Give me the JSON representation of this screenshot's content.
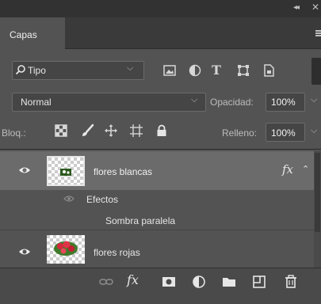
{
  "panel": {
    "collapse_glyph": "◂◂",
    "close_glyph": "✕",
    "tab_label": "Capas",
    "menu_icon": "panel-menu-icon"
  },
  "filter": {
    "kind_label": "Tipo",
    "search_icon": "search-icon",
    "chevron": "⌵",
    "filter_icons": [
      "image-icon",
      "adjustment-icon",
      "text-icon",
      "shape-icon",
      "smart-object-icon"
    ],
    "text_glyph": "T"
  },
  "blend": {
    "mode": "Normal",
    "chevron": "⌵",
    "opacity_label": "Opacidad:",
    "opacity_value": "100%"
  },
  "lock": {
    "label": "Bloq.:",
    "icons": [
      "lock-transparent-pixels-icon",
      "lock-image-pixels-icon",
      "lock-position-icon",
      "lock-artboard-icon",
      "lock-all-icon"
    ],
    "fill_label": "Relleno:",
    "fill_value": "100%"
  },
  "layers": [
    {
      "name": "flores blancas",
      "visible": true,
      "selected": true,
      "fx": "fx",
      "expand_glyph": "⌃",
      "effects_label": "Efectos",
      "effects": [
        "Sombra paralela"
      ]
    },
    {
      "name": "flores rojas",
      "visible": true,
      "selected": false
    }
  ],
  "toolbar": {
    "fx_label": "fx",
    "icons": [
      "link-layers-icon",
      "fx-icon",
      "add-mask-icon",
      "new-adjustment-icon",
      "new-group-icon",
      "new-layer-icon",
      "delete-icon"
    ]
  },
  "colors": {
    "panel_bg": "#535353",
    "selected_row": "#6b6b6b",
    "dark_bar": "#323232"
  }
}
